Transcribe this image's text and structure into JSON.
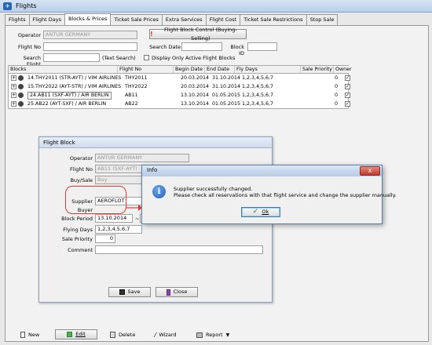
{
  "window": {
    "title": "Flights"
  },
  "tabs": [
    "Flights",
    "Flight Days",
    "Blocks & Prices",
    "Ticket Sale Prices",
    "Extra Services",
    "Flight Cost",
    "Ticket Sale Restrictions",
    "Stop Sale"
  ],
  "filters": {
    "operator_label": "Operator",
    "operator_value": "ANTUR GERMANY",
    "flight_no_label": "Flight No",
    "search_date_label": "Search Date",
    "block_id_label": "Block ID",
    "search_flight_label": "Search Flight",
    "text_search_hint": "(Text Search)",
    "active_only_label": "Display Only Active Flight Blocks",
    "control_button": "Flight Block Control (Buying-Selling)"
  },
  "grid": {
    "columns": [
      "Blocks",
      "Flight No",
      "Begin Date",
      "End Date",
      "Fly Days",
      "Sale Priority",
      "Owner"
    ],
    "rows": [
      {
        "block": "14.THY2011 (STR-AYT) / VIM AIRLINES",
        "flight": "THY2011",
        "begin": "20.03.2014",
        "end": "31.10.2014",
        "days": "1,2,3,4,5,6,7",
        "priority": "0",
        "owner": "✓"
      },
      {
        "block": "15.THY2022 (AYT-STR) / VIM AIRLINES",
        "flight": "THY2022",
        "begin": "20.03.2014",
        "end": "31.10.2014",
        "days": "1,2,3,4,5,6,7",
        "priority": "0",
        "owner": "✓"
      },
      {
        "block": "24.AB11 (SXF-AYT) / AIR BERLIN",
        "flight": "AB11",
        "begin": "13.10.2014",
        "end": "01.05.2015",
        "days": "1,2,3,4,5,6,7",
        "priority": "0",
        "owner": "✓"
      },
      {
        "block": "25.AB22 (AYT-SXF) / AIR BERLIN",
        "flight": "AB22",
        "begin": "13.10.2014",
        "end": "01.05.2015",
        "days": "1,2,3,4,5,6,7",
        "priority": "0",
        "owner": "✓"
      }
    ]
  },
  "flight_block": {
    "title": "Flight Block",
    "operator_label": "Operator",
    "operator_value": "ANTUR GERMANY",
    "flight_no_label": "Flight No",
    "flight_no_value": "AB11 (SXF-AYT)",
    "buy_sale_label": "Buy/Sale",
    "buy_sale_value": "Buy",
    "supplier_label": "Supplier",
    "supplier_value": "AEROFLOT",
    "buyer_label": "Buyer",
    "period_label": "Block Period",
    "period_start": "13.10.2014",
    "period_sep": "~",
    "fly_days_label": "Flying Days",
    "fly_days_value": "1,2,3,4,5,6,7",
    "sale_priority_label": "Sale Priority",
    "sale_priority_value": "0",
    "comment_label": "Comment",
    "save_label": "Save",
    "close_label": "Close"
  },
  "info_dialog": {
    "title": "Info",
    "message_line1": "Supplier successfully changed.",
    "message_line2": "Please check all reservations with that flight service and change the supplier manually.",
    "ok_label": "Ok",
    "icon_glyph": "i",
    "close_glyph": "x"
  },
  "bottom": {
    "new": "New",
    "edit": "Edit",
    "delete": "Delete",
    "wizard": "Wizard",
    "report": "Report"
  }
}
